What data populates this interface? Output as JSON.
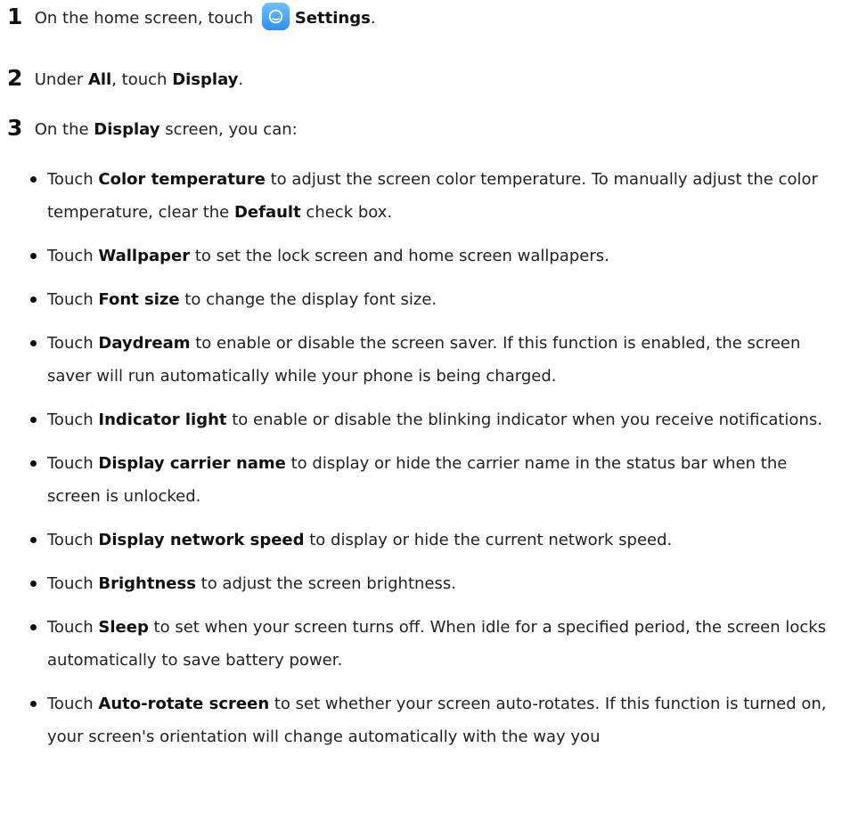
{
  "steps": [
    {
      "num": "1",
      "pre": "On the home screen, touch ",
      "icon": "settings-app-icon",
      "bold": "Settings",
      "post": "."
    },
    {
      "num": "2",
      "pre": "Under ",
      "bold1": "All",
      "mid": ", touch ",
      "bold2": "Display",
      "post": "."
    },
    {
      "num": "3",
      "pre": "On the ",
      "bold": "Display",
      "post": " screen, you can:"
    }
  ],
  "bullets": [
    {
      "pre": "Touch ",
      "bold": "Color temperature",
      "mid": " to adjust the screen color temperature. To manually adjust the color temperature, clear the ",
      "bold2": "Default",
      "post": " check box."
    },
    {
      "pre": "Touch ",
      "bold": "Wallpaper",
      "post": " to set the lock screen and home screen wallpapers."
    },
    {
      "pre": "Touch ",
      "bold": "Font size",
      "post": " to change the display font size."
    },
    {
      "pre": "Touch ",
      "bold": "Daydream",
      "post": " to enable or disable the screen saver. If this function is enabled, the screen saver will run automatically while your phone is being charged."
    },
    {
      "pre": "Touch ",
      "bold": "Indicator light",
      "post": " to enable or disable the blinking indicator when you receive notifications."
    },
    {
      "pre": "Touch ",
      "bold": "Display carrier name",
      "post": " to display or hide the carrier name in the status bar when the screen is unlocked."
    },
    {
      "pre": "Touch ",
      "bold": "Display network speed",
      "post": " to display or hide the current network speed."
    },
    {
      "pre": "Touch ",
      "bold": "Brightness",
      "post": " to adjust the screen brightness."
    },
    {
      "pre": "Touch ",
      "bold": "Sleep",
      "post": " to set when your screen turns off. When idle for a specified period, the screen locks automatically to save battery power."
    },
    {
      "pre": "Touch ",
      "bold": "Auto-rotate screen",
      "post": " to set whether your screen auto-rotates. If this function is turned on, your screen's orientation will change automatically with the way you"
    }
  ],
  "colors": {
    "text": "#222222",
    "icon_top": "#6fc0ff",
    "icon_bottom": "#2e8ff2"
  }
}
